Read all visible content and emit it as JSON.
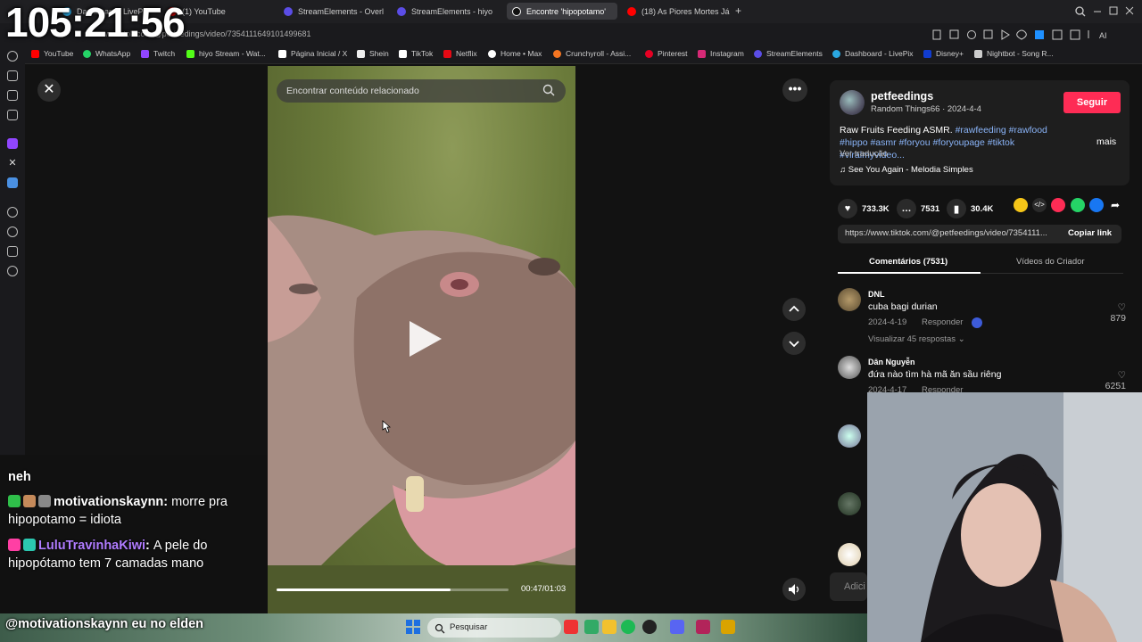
{
  "overlay": {
    "clock": "105:21:56"
  },
  "browser": {
    "tabs": [
      {
        "label": "Dashboard - LivePix",
        "color": "#2aa7e0"
      },
      {
        "label": "(1) YouTube",
        "color": "#ff0000"
      },
      {
        "label": "StreamElements - Overlay",
        "color": "#5b4de6"
      },
      {
        "label": "StreamElements - hiyo",
        "color": "#5b4de6"
      },
      {
        "label": "Encontre 'hipopotamo'",
        "color": "#ffffff"
      },
      {
        "label": "(18) As Piores Mortes Já D",
        "color": "#ff0000"
      }
    ],
    "new_tab": "+",
    "url": "www.tiktok.com/@petfeedings/video/7354111649101499681",
    "bookmarks": [
      {
        "label": "YouTube",
        "color": "#ff0000"
      },
      {
        "label": "WhatsApp",
        "color": "#25d366"
      },
      {
        "label": "Twitch",
        "color": "#9146ff"
      },
      {
        "label": "hiyo Stream - Wat...",
        "color": "#53fc18"
      },
      {
        "label": "Página Inicial / X",
        "color": "#ffffff"
      },
      {
        "label": "Shein",
        "color": "#eeeeee"
      },
      {
        "label": "TikTok",
        "color": "#ffffff"
      },
      {
        "label": "Netflix",
        "color": "#e50914"
      },
      {
        "label": "Home • Max",
        "color": "#ffffff"
      },
      {
        "label": "Crunchyroll - Assi...",
        "color": "#f47521"
      },
      {
        "label": "Pinterest",
        "color": "#e60023"
      },
      {
        "label": "Instagram",
        "color": "#d62976"
      },
      {
        "label": "StreamElements",
        "color": "#5b4de6"
      },
      {
        "label": "Dashboard - LivePix",
        "color": "#2aa7e0"
      },
      {
        "label": "Disney+",
        "color": "#113ccf"
      },
      {
        "label": "Nightbot - Song R...",
        "color": "#cccccc"
      }
    ]
  },
  "video": {
    "search_placeholder": "Encontrar conteúdo relacionado",
    "time": "00:47/01:03",
    "progress_fraction": 0.75
  },
  "post": {
    "username": "petfeedings",
    "subline": "Random Things66 · 2024-4-4",
    "follow_label": "Seguir",
    "caption_text": "Raw Fruits Feeding ASMR.",
    "caption_tags": "#rawfeeding #rawfood #hippo #asmr #foryou #foryoupage #tiktok #viralmyvideo...",
    "more_label": "mais",
    "translate_label": "Ver tradução",
    "music": "See You Again - Melodia Simples",
    "likes": "733.3K",
    "comments": "7531",
    "saves": "30.4K",
    "link": "https://www.tiktok.com/@petfeedings/video/7354111...",
    "copy_label": "Copiar link",
    "tab_comments": "Comentários (7531)",
    "tab_videos": "Vídeos do Criador"
  },
  "comments": [
    {
      "name": "DNL",
      "text": "cuba bagi durian",
      "date": "2024-4-19",
      "reply": "Responder",
      "likes": "879",
      "view_replies": "Visualizar 45 respostas"
    },
    {
      "name": "Dân Nguyễn",
      "text": "đứa nào tìm hà mã ăn sầu riêng",
      "date": "2024-4-17",
      "reply": "Responder",
      "likes": "6251"
    }
  ],
  "add_comment_placeholder": "Adici",
  "chat": {
    "line0": "neh",
    "user1": "motivationskaynn",
    "msg1": "morre pra hipopotamo = idiota",
    "user2": "LuluTravinhaKiwi",
    "msg2": "A pele do hipopótamo tem 7 camadas mano",
    "bottom": "@motivationskaynn eu no elden"
  },
  "taskbar": {
    "search_label": "Pesquisar"
  }
}
